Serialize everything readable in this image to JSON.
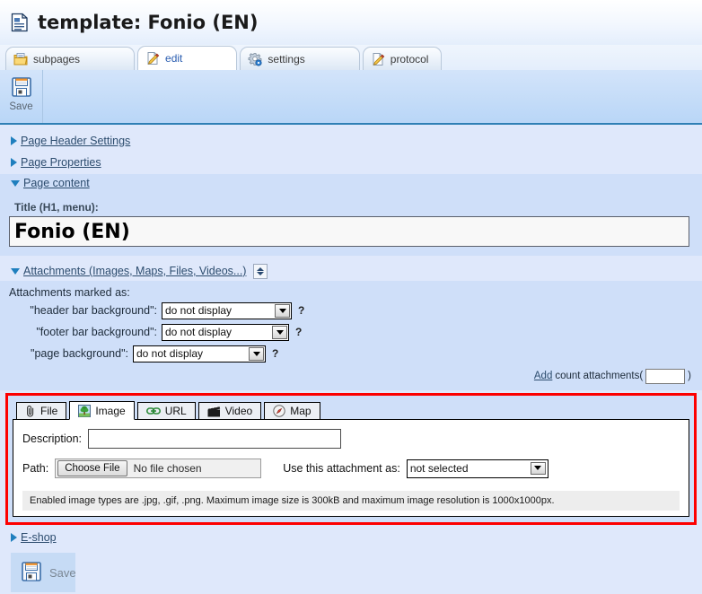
{
  "header": {
    "icon": "document-icon",
    "title": "template: Fonio (EN)"
  },
  "tabs": [
    {
      "label": "subpages",
      "icon": "folder-icon",
      "active": false
    },
    {
      "label": "edit",
      "icon": "pencil-page-icon",
      "active": true
    },
    {
      "label": "settings",
      "icon": "gear-icon",
      "active": false
    },
    {
      "label": "protocol",
      "icon": "pencil-page-icon",
      "active": false
    }
  ],
  "toolbar": {
    "save_label": "Save",
    "save_icon": "floppy-disk-icon"
  },
  "sections": [
    {
      "label": "Page Header Settings",
      "expanded": false
    },
    {
      "label": "Page Properties",
      "expanded": false
    },
    {
      "label": "Page content",
      "expanded": true
    }
  ],
  "page_content": {
    "title_label": "Title (H1, menu):",
    "title_value": "Fonio (EN)"
  },
  "attachments": {
    "header_label": "Attachments (Images, Maps, Files, Videos...)",
    "expanded": true,
    "marked_as_label": "Attachments marked as:",
    "rows": [
      {
        "label": "\"header bar background\":",
        "value": "do not display",
        "help": "?"
      },
      {
        "label": "\"footer bar background\":",
        "value": "do not display",
        "help": "?"
      },
      {
        "label": "\"page background\":",
        "value": "do not display",
        "help": "?"
      }
    ],
    "add_link": "Add",
    "add_text": "count attachments(",
    "add_close": ")",
    "count_value": ""
  },
  "editor": {
    "tabs": [
      {
        "label": "File",
        "icon": "paperclip-icon",
        "active": false
      },
      {
        "label": "Image",
        "icon": "tree-picture-icon",
        "active": true
      },
      {
        "label": "URL",
        "icon": "chain-link-icon",
        "active": false
      },
      {
        "label": "Video",
        "icon": "film-clapper-icon",
        "active": false
      },
      {
        "label": "Map",
        "icon": "compass-icon",
        "active": false
      }
    ],
    "description_label": "Description:",
    "description_value": "",
    "path_label": "Path:",
    "choose_file_label": "Choose File",
    "no_file_label": "No file chosen",
    "use_as_label": "Use this attachment as:",
    "use_as_value": "not selected",
    "hint": "Enabled image types are .jpg, .gif, .png. Maximum image size is 300kB and maximum image resolution is 1000x1000px."
  },
  "footer": {
    "eshop_label": "E-shop",
    "save_label": "Save",
    "save_icon": "floppy-disk-icon"
  },
  "colors": {
    "page_bg": "#dfe8fb",
    "section_bg": "#cfdff9",
    "toolbar_top": "#d3e4fa",
    "toolbar_bottom": "#b9d6f7",
    "toolbar_border": "#2f7fb5",
    "link": "#2c4c6e",
    "active_tab_text": "#2a5db0",
    "red_border": "#fd0000"
  }
}
